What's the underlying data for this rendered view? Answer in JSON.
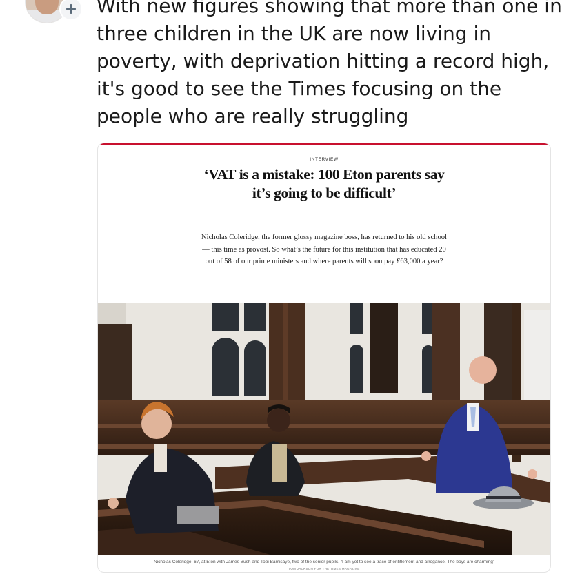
{
  "post": {
    "text": "With new figures showing that more than one in three children in the UK are now living in poverty, with deprivation hitting a record high, it's good to see the Times focusing on the people who are really struggling"
  },
  "article": {
    "kicker": "INTERVIEW",
    "headline": "‘VAT is a mistake: 100 Eton parents say it’s going to be difficult’",
    "standfirst": "Nicholas Coleridge, the former glossy magazine boss, has returned to his old school — this time as provost. So what’s the future for this institution that has educated 20 out of 58 of our prime ministers and where parents will soon pay £63,000 a year?",
    "caption": "Nicholas Coleridge, 67, at Eton with James Bush and Tobi Bamisaye, two of the senior pupils. “I am yet to see a trace of entitlement and arrogance. The boys are charming”",
    "credit": "TOM JACKSON FOR THE TIMES MAGAZINE"
  },
  "icons": {
    "follow": "plus-icon"
  },
  "colors": {
    "accent_rule": "#c8102e",
    "text": "#1a1a1a"
  }
}
